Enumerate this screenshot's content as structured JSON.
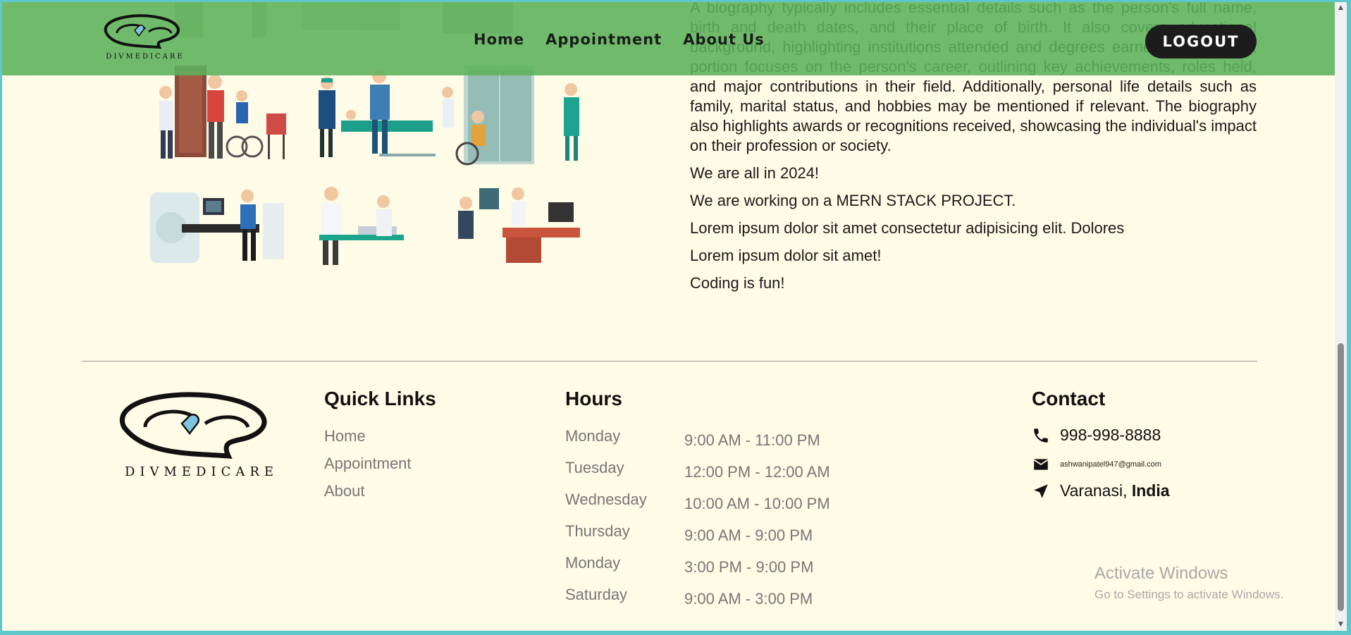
{
  "navbar": {
    "logo_text": "DIVMEDICARE",
    "links": [
      "Home",
      "Appointment",
      "About Us"
    ],
    "logout_label": "LOGOUT",
    "color": "#5cb25a"
  },
  "bio": {
    "paragraph": "A biography typically includes essential details such as the person's full name, birth and death dates, and their place of birth. It also covers educational background, highlighting institutions attended and degrees earned. A significant portion focuses on the person's career, outlining key achievements, roles held, and major contributions in their field. Additionally, personal life details such as family, marital status, and hobbies may be mentioned if relevant. The biography also highlights awards or recognitions received, showcasing the individual's impact on their profession or society.",
    "lines": [
      "We are all in 2024!",
      "We are working on a MERN STACK PROJECT.",
      "Lorem ipsum dolor sit amet consectetur adipisicing elit. Dolores",
      "Lorem ipsum dolor sit amet!",
      "Coding is fun!"
    ]
  },
  "footer": {
    "logo_text": "DIVMEDICARE",
    "quick_links": {
      "heading": "Quick Links",
      "items": [
        "Home",
        "Appointment",
        "About"
      ]
    },
    "hours": {
      "heading": "Hours",
      "rows": [
        {
          "day": "Monday",
          "time": "9:00 AM - 11:00 PM"
        },
        {
          "day": "Tuesday",
          "time": "12:00 PM - 12:00 AM"
        },
        {
          "day": "Wednesday",
          "time": "10:00 AM - 10:00 PM"
        },
        {
          "day": "Thursday",
          "time": "9:00 AM - 9:00 PM"
        },
        {
          "day": "Monday",
          "time": "3:00 PM - 9:00 PM"
        },
        {
          "day": "Saturday",
          "time": "9:00 AM - 3:00 PM"
        }
      ]
    },
    "contact": {
      "heading": "Contact",
      "phone": "998-998-8888",
      "email": "ashwanipatel947@gmail.com",
      "city": "Varanasi,",
      "country": "India"
    }
  },
  "watermark": {
    "title": "Activate Windows",
    "subtitle": "Go to Settings to activate Windows."
  },
  "icons": [
    "phone-icon",
    "mail-icon",
    "location-icon",
    "brain-heart-logo"
  ],
  "colors": {
    "page_bg": "#fefbe6",
    "frame": "#5fc6cc",
    "muted_text": "#777777"
  }
}
